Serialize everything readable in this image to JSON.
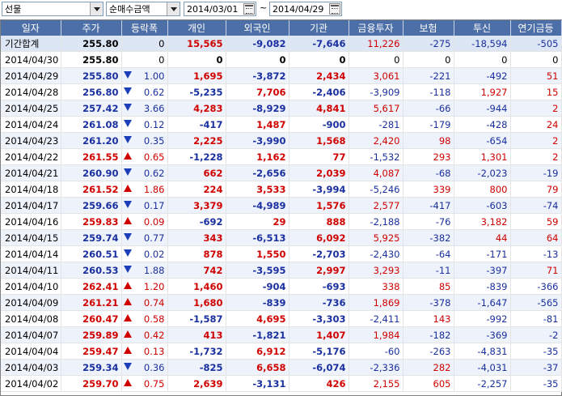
{
  "toolbar": {
    "instrument": "선물",
    "sort_option": "순매수금액",
    "date_from": "2014/03/01",
    "separator": "~",
    "date_to": "2014/04/29"
  },
  "columns": [
    "일자",
    "주가",
    "등락폭",
    "개인",
    "외국인",
    "기관",
    "금융투자",
    "보험",
    "투신",
    "연기금등"
  ],
  "colors": {
    "header_bg": "#4d6fa8",
    "up": "#d00000",
    "down": "#1a2fa0",
    "row_alt": "#eef2fa"
  },
  "rows": [
    {
      "date": "기간합계",
      "price": "255.80",
      "dir": "",
      "chg": "0",
      "indiv": "15,565",
      "foreign": "-9,082",
      "inst": "-7,646",
      "fin": "11,226",
      "ins": "-275",
      "trust": "-18,594",
      "pension": "-505"
    },
    {
      "date": "2014/04/30",
      "price": "255.80",
      "dir": "",
      "chg": "0",
      "indiv": "0",
      "foreign": "0",
      "inst": "0",
      "fin": "0",
      "ins": "0",
      "trust": "0",
      "pension": "0"
    },
    {
      "date": "2014/04/29",
      "price": "255.80",
      "dir": "down",
      "chg": "1.00",
      "indiv": "1,695",
      "foreign": "-3,872",
      "inst": "2,434",
      "fin": "3,061",
      "ins": "-221",
      "trust": "-492",
      "pension": "51"
    },
    {
      "date": "2014/04/28",
      "price": "256.80",
      "dir": "down",
      "chg": "0.62",
      "indiv": "-5,235",
      "foreign": "7,706",
      "inst": "-2,406",
      "fin": "-3,909",
      "ins": "-118",
      "trust": "1,927",
      "pension": "15"
    },
    {
      "date": "2014/04/25",
      "price": "257.42",
      "dir": "down",
      "chg": "3.66",
      "indiv": "4,283",
      "foreign": "-8,929",
      "inst": "4,841",
      "fin": "5,617",
      "ins": "-66",
      "trust": "-944",
      "pension": "2"
    },
    {
      "date": "2014/04/24",
      "price": "261.08",
      "dir": "down",
      "chg": "0.12",
      "indiv": "-417",
      "foreign": "1,487",
      "inst": "-900",
      "fin": "-281",
      "ins": "-179",
      "trust": "-428",
      "pension": "24"
    },
    {
      "date": "2014/04/23",
      "price": "261.20",
      "dir": "down",
      "chg": "0.35",
      "indiv": "2,225",
      "foreign": "-3,990",
      "inst": "1,568",
      "fin": "2,420",
      "ins": "98",
      "trust": "-654",
      "pension": "2"
    },
    {
      "date": "2014/04/22",
      "price": "261.55",
      "dir": "up",
      "chg": "0.65",
      "indiv": "-1,228",
      "foreign": "1,162",
      "inst": "77",
      "fin": "-1,532",
      "ins": "293",
      "trust": "1,301",
      "pension": "2"
    },
    {
      "date": "2014/04/21",
      "price": "260.90",
      "dir": "down",
      "chg": "0.62",
      "indiv": "662",
      "foreign": "-2,656",
      "inst": "2,039",
      "fin": "4,087",
      "ins": "-68",
      "trust": "-2,023",
      "pension": "-19"
    },
    {
      "date": "2014/04/18",
      "price": "261.52",
      "dir": "up",
      "chg": "1.86",
      "indiv": "224",
      "foreign": "3,533",
      "inst": "-3,994",
      "fin": "-5,246",
      "ins": "339",
      "trust": "800",
      "pension": "79"
    },
    {
      "date": "2014/04/17",
      "price": "259.66",
      "dir": "down",
      "chg": "0.17",
      "indiv": "3,379",
      "foreign": "-4,989",
      "inst": "1,576",
      "fin": "2,577",
      "ins": "-417",
      "trust": "-603",
      "pension": "-74"
    },
    {
      "date": "2014/04/16",
      "price": "259.83",
      "dir": "up",
      "chg": "0.09",
      "indiv": "-692",
      "foreign": "29",
      "inst": "888",
      "fin": "-2,188",
      "ins": "-76",
      "trust": "3,182",
      "pension": "59"
    },
    {
      "date": "2014/04/15",
      "price": "259.74",
      "dir": "down",
      "chg": "0.77",
      "indiv": "343",
      "foreign": "-6,513",
      "inst": "6,092",
      "fin": "5,925",
      "ins": "-382",
      "trust": "44",
      "pension": "64"
    },
    {
      "date": "2014/04/14",
      "price": "260.51",
      "dir": "down",
      "chg": "0.02",
      "indiv": "878",
      "foreign": "1,550",
      "inst": "-2,703",
      "fin": "-2,430",
      "ins": "-64",
      "trust": "-171",
      "pension": "-13"
    },
    {
      "date": "2014/04/11",
      "price": "260.53",
      "dir": "down",
      "chg": "1.88",
      "indiv": "742",
      "foreign": "-3,595",
      "inst": "2,997",
      "fin": "3,293",
      "ins": "-11",
      "trust": "-397",
      "pension": "71"
    },
    {
      "date": "2014/04/10",
      "price": "262.41",
      "dir": "up",
      "chg": "1.20",
      "indiv": "1,460",
      "foreign": "-904",
      "inst": "-693",
      "fin": "338",
      "ins": "85",
      "trust": "-839",
      "pension": "-366"
    },
    {
      "date": "2014/04/09",
      "price": "261.21",
      "dir": "up",
      "chg": "0.74",
      "indiv": "1,680",
      "foreign": "-839",
      "inst": "-736",
      "fin": "1,869",
      "ins": "-378",
      "trust": "-1,647",
      "pension": "-565"
    },
    {
      "date": "2014/04/08",
      "price": "260.47",
      "dir": "up",
      "chg": "0.58",
      "indiv": "-1,587",
      "foreign": "4,695",
      "inst": "-3,303",
      "fin": "-2,411",
      "ins": "143",
      "trust": "-992",
      "pension": "-81"
    },
    {
      "date": "2014/04/07",
      "price": "259.89",
      "dir": "up",
      "chg": "0.42",
      "indiv": "413",
      "foreign": "-1,821",
      "inst": "1,407",
      "fin": "1,984",
      "ins": "-182",
      "trust": "-369",
      "pension": "-2"
    },
    {
      "date": "2014/04/04",
      "price": "259.47",
      "dir": "up",
      "chg": "0.13",
      "indiv": "-1,732",
      "foreign": "6,912",
      "inst": "-5,176",
      "fin": "-60",
      "ins": "-263",
      "trust": "-4,831",
      "pension": "-35"
    },
    {
      "date": "2014/04/03",
      "price": "259.34",
      "dir": "down",
      "chg": "0.36",
      "indiv": "-825",
      "foreign": "6,658",
      "inst": "-6,074",
      "fin": "-2,336",
      "ins": "282",
      "trust": "-4,031",
      "pension": "-37"
    },
    {
      "date": "2014/04/02",
      "price": "259.70",
      "dir": "up",
      "chg": "0.75",
      "indiv": "2,639",
      "foreign": "-3,131",
      "inst": "426",
      "fin": "2,155",
      "ins": "605",
      "trust": "-2,257",
      "pension": "-35"
    }
  ]
}
